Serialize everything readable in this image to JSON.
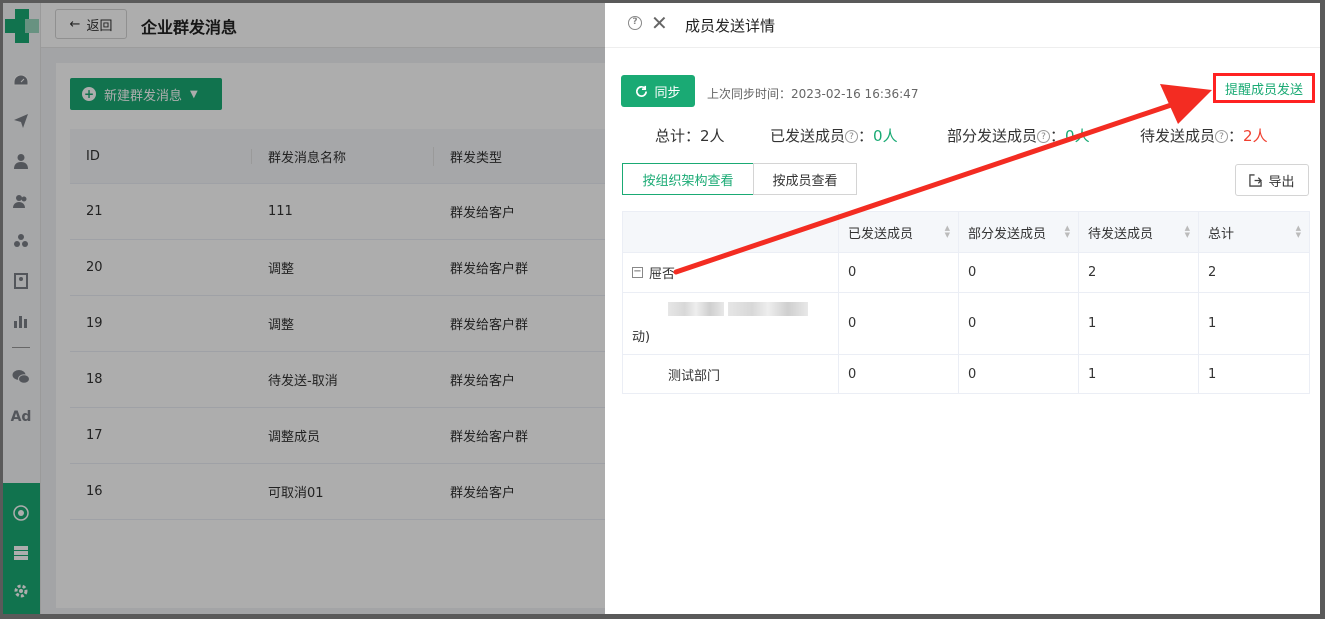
{
  "page": {
    "back_label": "返回",
    "title": "企业群发消息",
    "new_button": "新建群发消息"
  },
  "bg_table": {
    "headers": [
      "ID",
      "群发消息名称",
      "群发类型"
    ],
    "rows": [
      [
        "21",
        "111",
        "群发给客户"
      ],
      [
        "20",
        "调整",
        "群发给客户群"
      ],
      [
        "19",
        "调整",
        "群发给客户群"
      ],
      [
        "18",
        "待发送-取消",
        "群发给客户"
      ],
      [
        "17",
        "调整成员",
        "群发给客户群"
      ],
      [
        "16",
        "可取消01",
        "群发给客户"
      ]
    ]
  },
  "rail": {
    "icons": [
      "dashboard-icon",
      "send-icon",
      "user-icon",
      "users-icon",
      "group-icon",
      "bookmark-icon",
      "bar-chart-icon",
      "wechat-icon",
      "ad-icon",
      "settings-circle-icon",
      "server-icon",
      "gear-icon"
    ],
    "ad_label": "Ad"
  },
  "drawer": {
    "title": "成员发送详情",
    "sync_label": "同步",
    "sync_time": "上次同步时间：2023-02-16 16:36:47",
    "remind_label": "提醒成员发送",
    "stats": {
      "total_label": "总计：",
      "total_value": "2人",
      "sent_label": "已发送成员",
      "sent_value": "0人",
      "partial_label": "部分发送成员",
      "partial_value": "0人",
      "pending_label": "待发送成员",
      "pending_value": "2人"
    },
    "tabs": [
      "按组织架构查看",
      "按成员查看"
    ],
    "export_label": "导出",
    "table": {
      "headers": [
        "",
        "已发送成员",
        "部分发送成员",
        "待发送成员",
        "总计"
      ],
      "rows": [
        {
          "name": "屉否",
          "sent": "0",
          "partial": "0",
          "pending": "2",
          "total": "2"
        },
        {
          "name": "动)",
          "sent": "0",
          "partial": "0",
          "pending": "1",
          "total": "1"
        },
        {
          "name": "测试部门",
          "sent": "0",
          "partial": "0",
          "pending": "1",
          "total": "1"
        }
      ]
    },
    "colors": {
      "accent": "#1aaa74",
      "highlight": "#ff2222",
      "danger": "#f04030"
    }
  }
}
